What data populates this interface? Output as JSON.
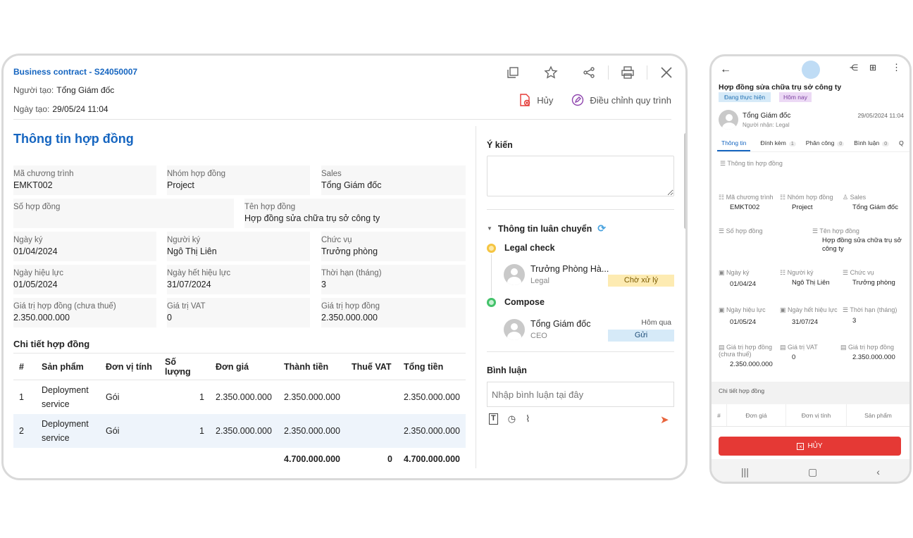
{
  "desk": {
    "title": "Business contract - S24050007",
    "creator_label": "Người tạo:",
    "creator": "Tổng Giám đốc",
    "date_label": "Ngày tạo:",
    "date": "29/05/24 11:04",
    "cancel": "Hủy",
    "adjust": "Điều chỉnh quy trình",
    "section_title": "Thông tin hợp đồng",
    "fields": [
      {
        "label": "Mã chương trình",
        "value": "EMKT002"
      },
      {
        "label": "Nhóm hợp đồng",
        "value": "Project"
      },
      {
        "label": "Sales",
        "value": "Tổng Giám đốc"
      },
      {
        "label": "Số hợp đồng",
        "value": ""
      },
      {
        "label": "Tên hợp đồng",
        "value": "Hợp đồng sửa chữa trụ sở công ty"
      },
      {
        "label": "Ngày ký",
        "value": "01/04/2024"
      },
      {
        "label": "Người ký",
        "value": "Ngô Thị Liên"
      },
      {
        "label": "Chức vụ",
        "value": "Trưởng phòng"
      },
      {
        "label": "Ngày hiệu lực",
        "value": "01/05/2024"
      },
      {
        "label": "Ngày hết hiệu lực",
        "value": "31/07/2024"
      },
      {
        "label": "Thời hạn (tháng)",
        "value": "3"
      },
      {
        "label": "Giá trị hợp đồng (chưa thuế)",
        "value": "2.350.000.000"
      },
      {
        "label": "Giá trị VAT",
        "value": "0"
      },
      {
        "label": "Giá trị hợp đồng",
        "value": "2.350.000.000"
      }
    ],
    "detail_title": "Chi tiết hợp đồng",
    "columns": [
      "#",
      "Sản phẩm",
      "Đơn vị tính",
      "Số lượng",
      "Đơn giá",
      "Thành tiền",
      "Thuế VAT",
      "Tổng tiền"
    ],
    "rows": [
      [
        "1",
        "Deployment service",
        "Gói",
        "1",
        "2.350.000.000",
        "2.350.000.000",
        "",
        "2.350.000.000"
      ],
      [
        "2",
        "Deployment service",
        "Gói",
        "1",
        "2.350.000.000",
        "2.350.000.000",
        "",
        "2.350.000.000"
      ]
    ],
    "totals": {
      "amount": "4.700.000.000",
      "vat": "0",
      "total": "4.700.000.000"
    },
    "opinion_label": "Ý kiến",
    "flow_label": "Thông tin luân chuyển",
    "steps": [
      {
        "name": "Legal check",
        "person": "Trưởng Phòng Hà...",
        "role": "Legal",
        "badge": "Chờ xử lý",
        "time": ""
      },
      {
        "name": "Compose",
        "person": "Tổng Giám đốc",
        "role": "CEO",
        "badge": "Gửi",
        "time": "Hôm qua"
      }
    ],
    "comment_label": "Bình luận",
    "comment_placeholder": "Nhập bình luận tại đây",
    "colors": {
      "accent": "#1565c0",
      "pending": "#fdebb2",
      "sent": "#d6eaf8",
      "step1": "#f5c542",
      "step2": "#43c26a"
    }
  },
  "phone": {
    "title": "Hợp đồng sửa chữa trụ sở công ty",
    "status": "Đang thực hiện",
    "today": "Hôm nay",
    "sender": "Tổng Giám đốc",
    "date": "29/05/2024 11:04",
    "receiver": "Người nhận: Legal",
    "tabs": [
      {
        "label": "Thông tin",
        "count": ""
      },
      {
        "label": "Đính kèm",
        "count": "1"
      },
      {
        "label": "Phân công",
        "count": "0"
      },
      {
        "label": "Bình luận",
        "count": "0"
      },
      {
        "label": "Q",
        "count": ""
      }
    ],
    "section": "Thông tin hợp đồng",
    "f1": {
      "a": "Mã chương trình",
      "av": "EMKT002",
      "b": "Nhóm hợp đồng",
      "bv": "Project",
      "c": "Sales",
      "cv": "Tổng Giám đốc"
    },
    "f2": {
      "a": "Số hợp đồng",
      "b": "Tên hợp đồng",
      "bv": "Hợp đồng sửa chữa trụ sở công ty"
    },
    "f3": {
      "a": "Ngày ký",
      "av": "01/04/24",
      "b": "Người ký",
      "bv": "Ngô Thị Liên",
      "c": "Chức vụ",
      "cv": "Trưởng phòng"
    },
    "f4": {
      "a": "Ngày hiệu lực",
      "av": "01/05/24",
      "b": "Ngày hết hiệu lực",
      "bv": "31/07/24",
      "c": "Thời hạn (tháng)",
      "cv": "3"
    },
    "f5": {
      "a": "Giá trị hợp đồng (chưa thuế)",
      "av": "2.350.000.000",
      "b": "Giá trị VAT",
      "bv": "0",
      "c": "Giá trị hợp đồng",
      "cv": "2.350.000.000"
    },
    "detail": "Chi tiết hợp đồng",
    "cols": [
      "#",
      "Đơn giá",
      "Đơn vị tính",
      "Sản phẩm"
    ],
    "cancel": "HỦY"
  }
}
